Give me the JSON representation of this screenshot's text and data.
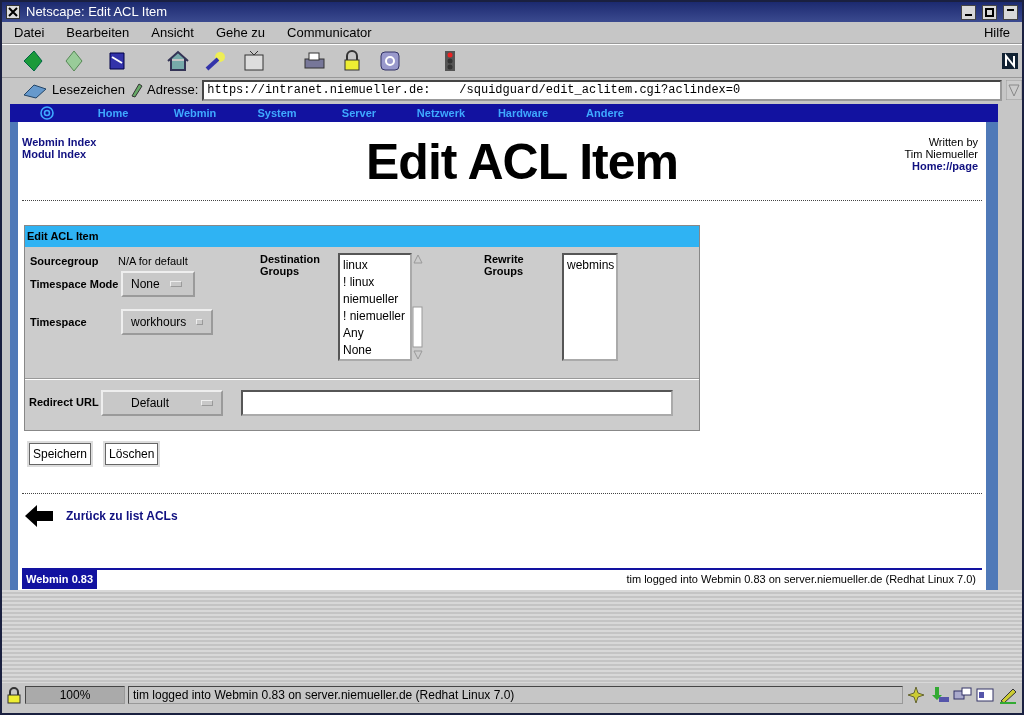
{
  "window": {
    "title": "Netscape: Edit ACL Item"
  },
  "menu": {
    "items": [
      "Datei",
      "Bearbeiten",
      "Ansicht",
      "Gehe zu",
      "Communicator"
    ],
    "help": "Hilfe"
  },
  "location_bar": {
    "bookmarks": "Lesezeichen",
    "address_label": "Adresse:",
    "url": "https://intranet.niemueller.de:    /squidguard/edit_aclitem.cgi?aclindex=0"
  },
  "webmin_nav": [
    "Home",
    "Webmin",
    "System",
    "Server",
    "Netzwerk",
    "Hardware",
    "Andere"
  ],
  "page": {
    "links": [
      "Webmin Index",
      "Modul Index"
    ],
    "title": "Edit ACL Item",
    "written_by": "Written by",
    "author": "Tim Niemueller",
    "home_link": "Home://page"
  },
  "form": {
    "header": "Edit ACL Item",
    "sourcegroup": {
      "label": "Sourcegroup",
      "value": "N/A for default"
    },
    "timespace_mode": {
      "label": "Timespace Mode",
      "value": "None"
    },
    "timespace": {
      "label": "Timespace",
      "value": "workhours"
    },
    "destination_groups": {
      "label": "Destination Groups",
      "options": [
        "linux",
        "! linux",
        "niemueller",
        "! niemueller",
        "Any",
        "None"
      ]
    },
    "rewrite_groups": {
      "label": "Rewrite Groups",
      "options": [
        "webmins"
      ]
    },
    "redirect": {
      "label": "Redirect URL",
      "mode": "Default"
    }
  },
  "buttons": [
    "Speichern",
    "Löschen"
  ],
  "back_link": "Zurück zu list ACLs",
  "footer": {
    "version": "Webmin 0.83",
    "login": "tim logged into Webmin 0.83 on server.niemueller.de (Redhat Linux 7.0)"
  },
  "status_bar": {
    "zoom": "100%",
    "message": "tim logged into Webmin 0.83 on server.niemueller.de (Redhat Linux 7.0)"
  }
}
